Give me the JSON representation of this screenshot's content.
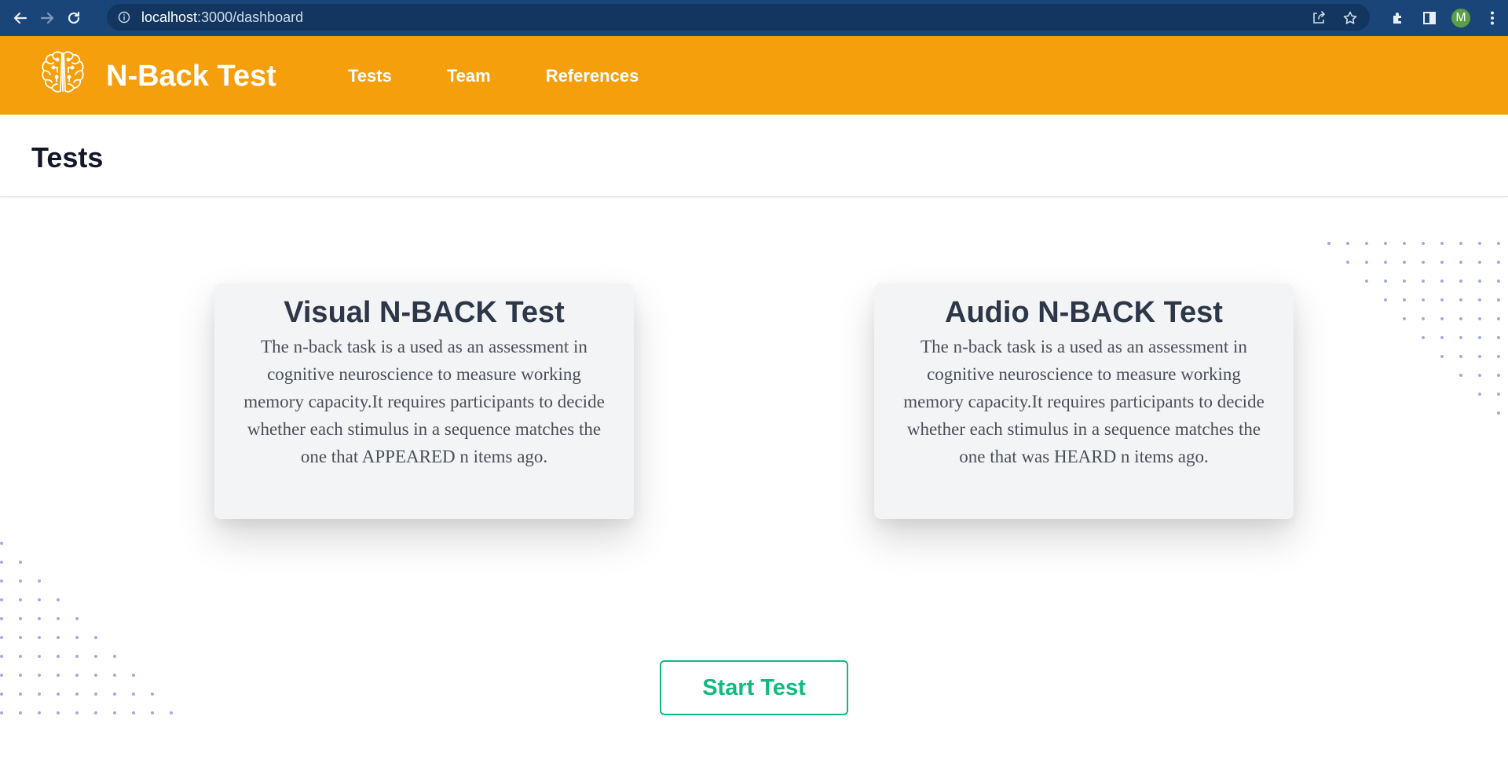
{
  "browser": {
    "url_host": "localhost",
    "url_path": ":3000/dashboard",
    "avatar_letter": "M",
    "icons": [
      "back-arrow-icon",
      "forward-arrow-icon",
      "reload-icon",
      "site-info-icon",
      "share-icon",
      "bookmark-star-icon",
      "extensions-icon",
      "side-panel-icon",
      "menu-dots-icon"
    ]
  },
  "header": {
    "brand": "N-Back Test",
    "logo_icon": "brain-icon",
    "nav": [
      {
        "label": "Tests"
      },
      {
        "label": "Team"
      },
      {
        "label": "References"
      }
    ]
  },
  "page": {
    "title": "Tests"
  },
  "cards": [
    {
      "title": "Visual N-BACK Test",
      "description": "The n-back task is a used as an assessment in cognitive neuroscience to measure working memory capacity.It requires participants to decide whether each stimulus in a sequence matches the one that APPEARED n items ago."
    },
    {
      "title": "Audio N-BACK Test",
      "description": "The n-back task is a used as an assessment in cognitive neuroscience to measure working memory capacity.It requires participants to decide whether each stimulus in a sequence matches the one that was HEARD n items ago."
    }
  ],
  "action": {
    "start_label": "Start Test"
  },
  "colors": {
    "header_bg": "#f59f0c",
    "browser_bar": "#1a4578",
    "accent_green": "#10b981",
    "dot_pattern": "#a5a9e3"
  }
}
